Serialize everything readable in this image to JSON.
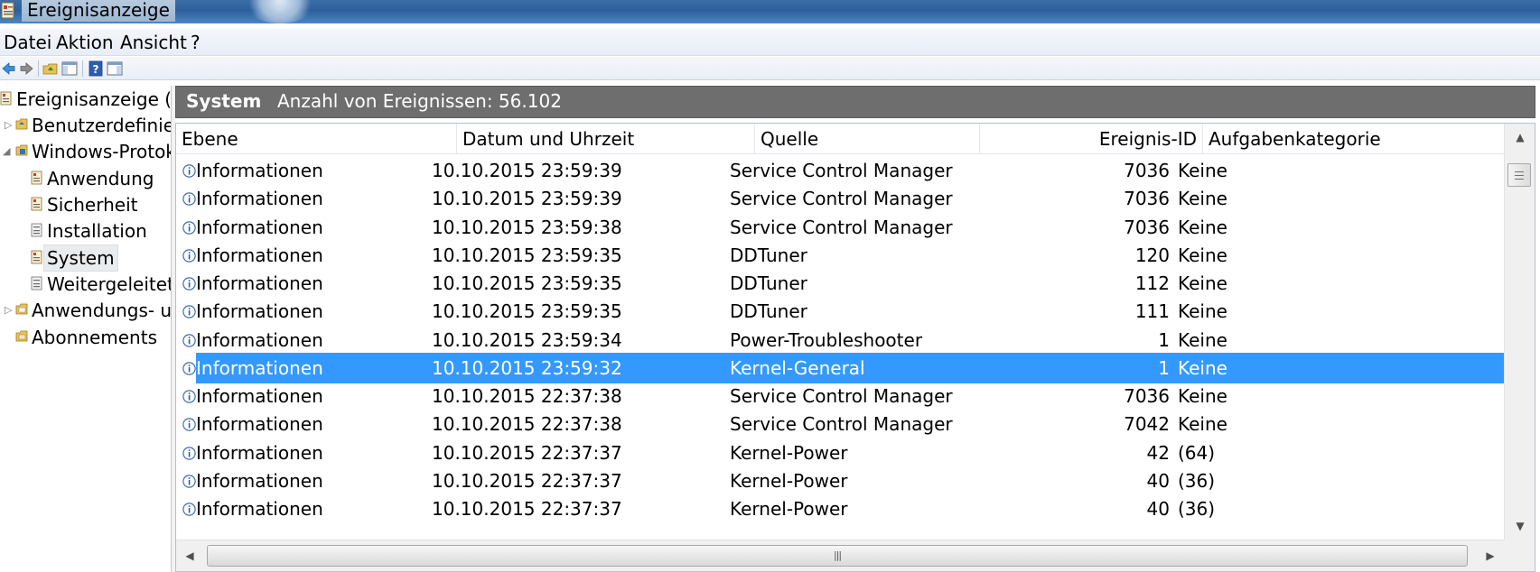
{
  "window": {
    "title": "Ereignisanzeige"
  },
  "menu": {
    "items": [
      "Datei",
      "Aktion",
      "Ansicht",
      "?"
    ]
  },
  "toolbar": {
    "buttons": [
      "back-arrow-icon",
      "forward-arrow-icon",
      "up-folder-icon",
      "show-hide-tree-icon",
      "help-icon",
      "show-hide-action-pane-icon"
    ]
  },
  "tree": {
    "items": [
      {
        "label": "Ereignisanzeige (Lo",
        "icon": "event-viewer-icon"
      },
      {
        "label": "Benutzerdefinier",
        "icon": "custom-views-folder-icon"
      },
      {
        "label": "Windows-Protok",
        "icon": "windows-logs-folder-icon"
      },
      {
        "label": "Anwendung",
        "icon": "log-icon"
      },
      {
        "label": "Sicherheit",
        "icon": "log-icon"
      },
      {
        "label": "Installation",
        "icon": "log-icon"
      },
      {
        "label": "System",
        "icon": "log-icon"
      },
      {
        "label": "Weitergeleitet",
        "icon": "log-icon"
      },
      {
        "label": "Anwendungs- u",
        "icon": "app-logs-folder-icon"
      },
      {
        "label": "Abonnements",
        "icon": "subscriptions-icon"
      }
    ],
    "selected": "System"
  },
  "header": {
    "log_name": "System",
    "event_count_label": "Anzahl von Ereignissen: 56.102"
  },
  "columns": [
    "Ebene",
    "Datum und Uhrzeit",
    "Quelle",
    "Ereignis-ID",
    "Aufgabenkategorie"
  ],
  "events": [
    {
      "level": "Informationen",
      "datetime": "10.10.2015 23:59:39",
      "source": "Service Control Manager",
      "id": "7036",
      "category": "Keine"
    },
    {
      "level": "Informationen",
      "datetime": "10.10.2015 23:59:39",
      "source": "Service Control Manager",
      "id": "7036",
      "category": "Keine"
    },
    {
      "level": "Informationen",
      "datetime": "10.10.2015 23:59:38",
      "source": "Service Control Manager",
      "id": "7036",
      "category": "Keine"
    },
    {
      "level": "Informationen",
      "datetime": "10.10.2015 23:59:35",
      "source": "DDTuner",
      "id": "120",
      "category": "Keine"
    },
    {
      "level": "Informationen",
      "datetime": "10.10.2015 23:59:35",
      "source": "DDTuner",
      "id": "112",
      "category": "Keine"
    },
    {
      "level": "Informationen",
      "datetime": "10.10.2015 23:59:35",
      "source": "DDTuner",
      "id": "111",
      "category": "Keine"
    },
    {
      "level": "Informationen",
      "datetime": "10.10.2015 23:59:34",
      "source": "Power-Troubleshooter",
      "id": "1",
      "category": "Keine"
    },
    {
      "level": "Informationen",
      "datetime": "10.10.2015 23:59:32",
      "source": "Kernel-General",
      "id": "1",
      "category": "Keine"
    },
    {
      "level": "Informationen",
      "datetime": "10.10.2015 22:37:38",
      "source": "Service Control Manager",
      "id": "7036",
      "category": "Keine"
    },
    {
      "level": "Informationen",
      "datetime": "10.10.2015 22:37:38",
      "source": "Service Control Manager",
      "id": "7042",
      "category": "Keine"
    },
    {
      "level": "Informationen",
      "datetime": "10.10.2015 22:37:37",
      "source": "Kernel-Power",
      "id": "42",
      "category": "(64)"
    },
    {
      "level": "Informationen",
      "datetime": "10.10.2015 22:37:37",
      "source": "Kernel-Power",
      "id": "40",
      "category": "(36)"
    },
    {
      "level": "Informationen",
      "datetime": "10.10.2015 22:37:37",
      "source": "Kernel-Power",
      "id": "40",
      "category": "(36)"
    }
  ],
  "selected_event_index": 7,
  "colors": {
    "selection": "#3399ff",
    "header_band": "#6e6e6e"
  }
}
